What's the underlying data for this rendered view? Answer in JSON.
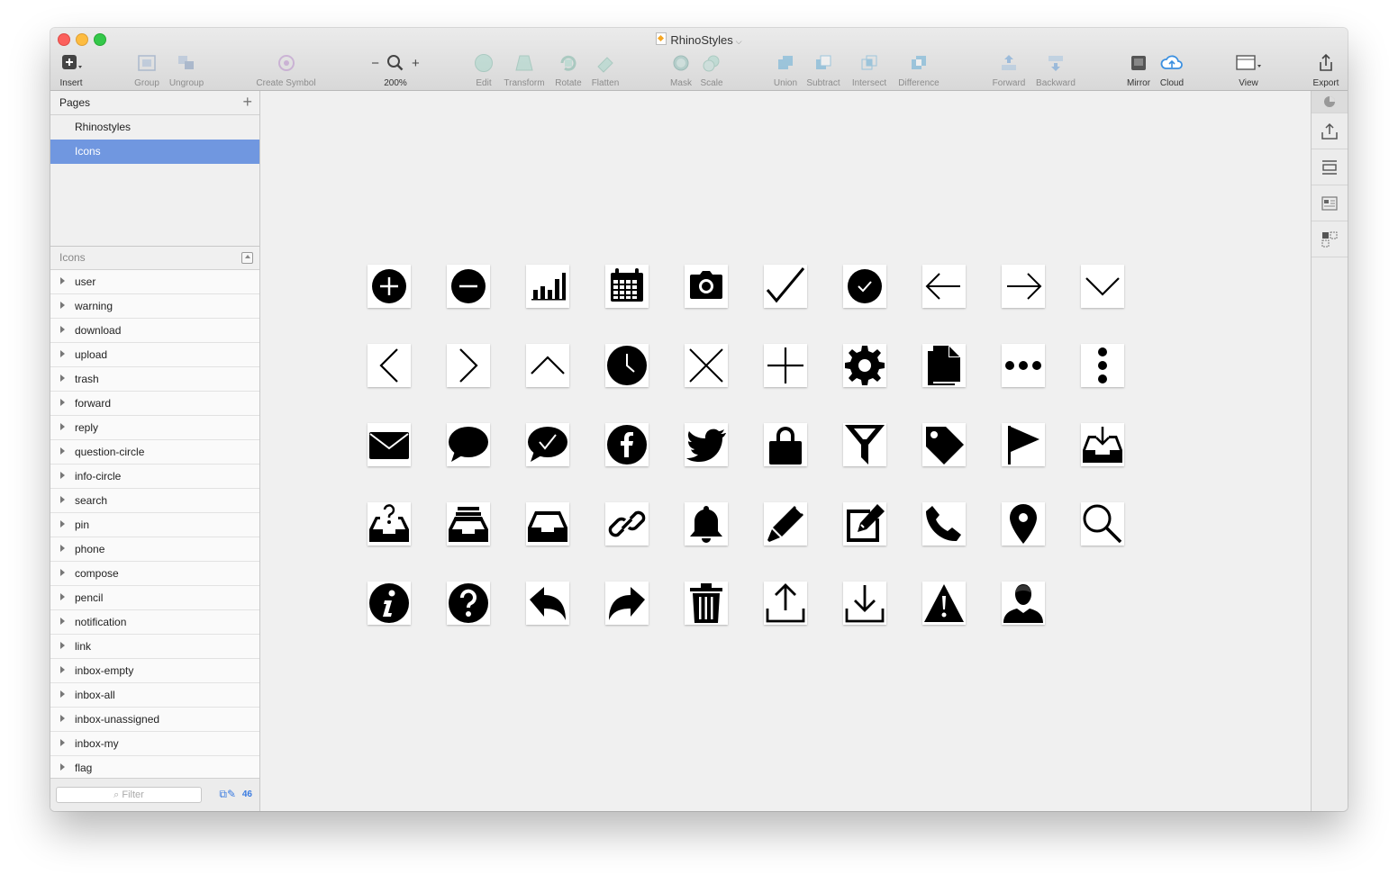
{
  "window": {
    "title": "RhinoStyles"
  },
  "toolbar": {
    "insert": "Insert",
    "group": "Group",
    "ungroup": "Ungroup",
    "create_symbol": "Create Symbol",
    "zoom_minus": "−",
    "zoom_plus": "+",
    "zoom_level": "200%",
    "edit": "Edit",
    "transform": "Transform",
    "rotate": "Rotate",
    "flatten": "Flatten",
    "mask": "Mask",
    "scale": "Scale",
    "union": "Union",
    "subtract": "Subtract",
    "intersect": "Intersect",
    "difference": "Difference",
    "forward": "Forward",
    "backward": "Backward",
    "mirror": "Mirror",
    "cloud": "Cloud",
    "view": "View",
    "export": "Export"
  },
  "pages": {
    "header": "Pages",
    "items": [
      "Rhinostyles",
      "Icons"
    ],
    "selected": "Icons"
  },
  "layers": {
    "header": "Icons",
    "items": [
      "user",
      "warning",
      "download",
      "upload",
      "trash",
      "forward",
      "reply",
      "question-circle",
      "info-circle",
      "search",
      "pin",
      "phone",
      "compose",
      "pencil",
      "notification",
      "link",
      "inbox-empty",
      "inbox-all",
      "inbox-unassigned",
      "inbox-my",
      "flag"
    ]
  },
  "filter": {
    "placeholder": "Filter",
    "count": "46"
  },
  "canvas": {
    "rows": [
      [
        "plus-circle-icon",
        "minus-circle-icon",
        "bar-chart-icon",
        "calendar-icon",
        "camera-icon",
        "checkmark-icon",
        "check-circle-icon",
        "arrow-left-icon",
        "arrow-right-icon",
        "chevron-down-icon"
      ],
      [
        "chevron-left-icon",
        "chevron-right-icon",
        "chevron-up-icon",
        "clock-icon",
        "close-icon",
        "plus-icon",
        "gear-icon",
        "document-icon",
        "more-horizontal-icon",
        "more-vertical-icon"
      ],
      [
        "mail-icon",
        "chat-bubble-icon",
        "chat-check-icon",
        "facebook-icon",
        "twitter-icon",
        "lock-icon",
        "filter-icon",
        "tag-icon",
        "flag-icon",
        "inbox-download-icon"
      ],
      [
        "inbox-unassigned-icon",
        "inbox-all-icon",
        "inbox-empty-icon",
        "link-icon",
        "notification-bell-icon",
        "pencil-icon",
        "compose-icon",
        "phone-icon",
        "pin-icon",
        "search-icon"
      ],
      [
        "info-circle-icon",
        "question-circle-icon",
        "reply-icon",
        "forward-icon",
        "trash-icon",
        "upload-icon",
        "download-icon",
        "warning-icon",
        "user-icon"
      ]
    ]
  },
  "colors": {
    "selection": "#7097e0",
    "accent": "#3a7be0",
    "icon": "#000000"
  }
}
